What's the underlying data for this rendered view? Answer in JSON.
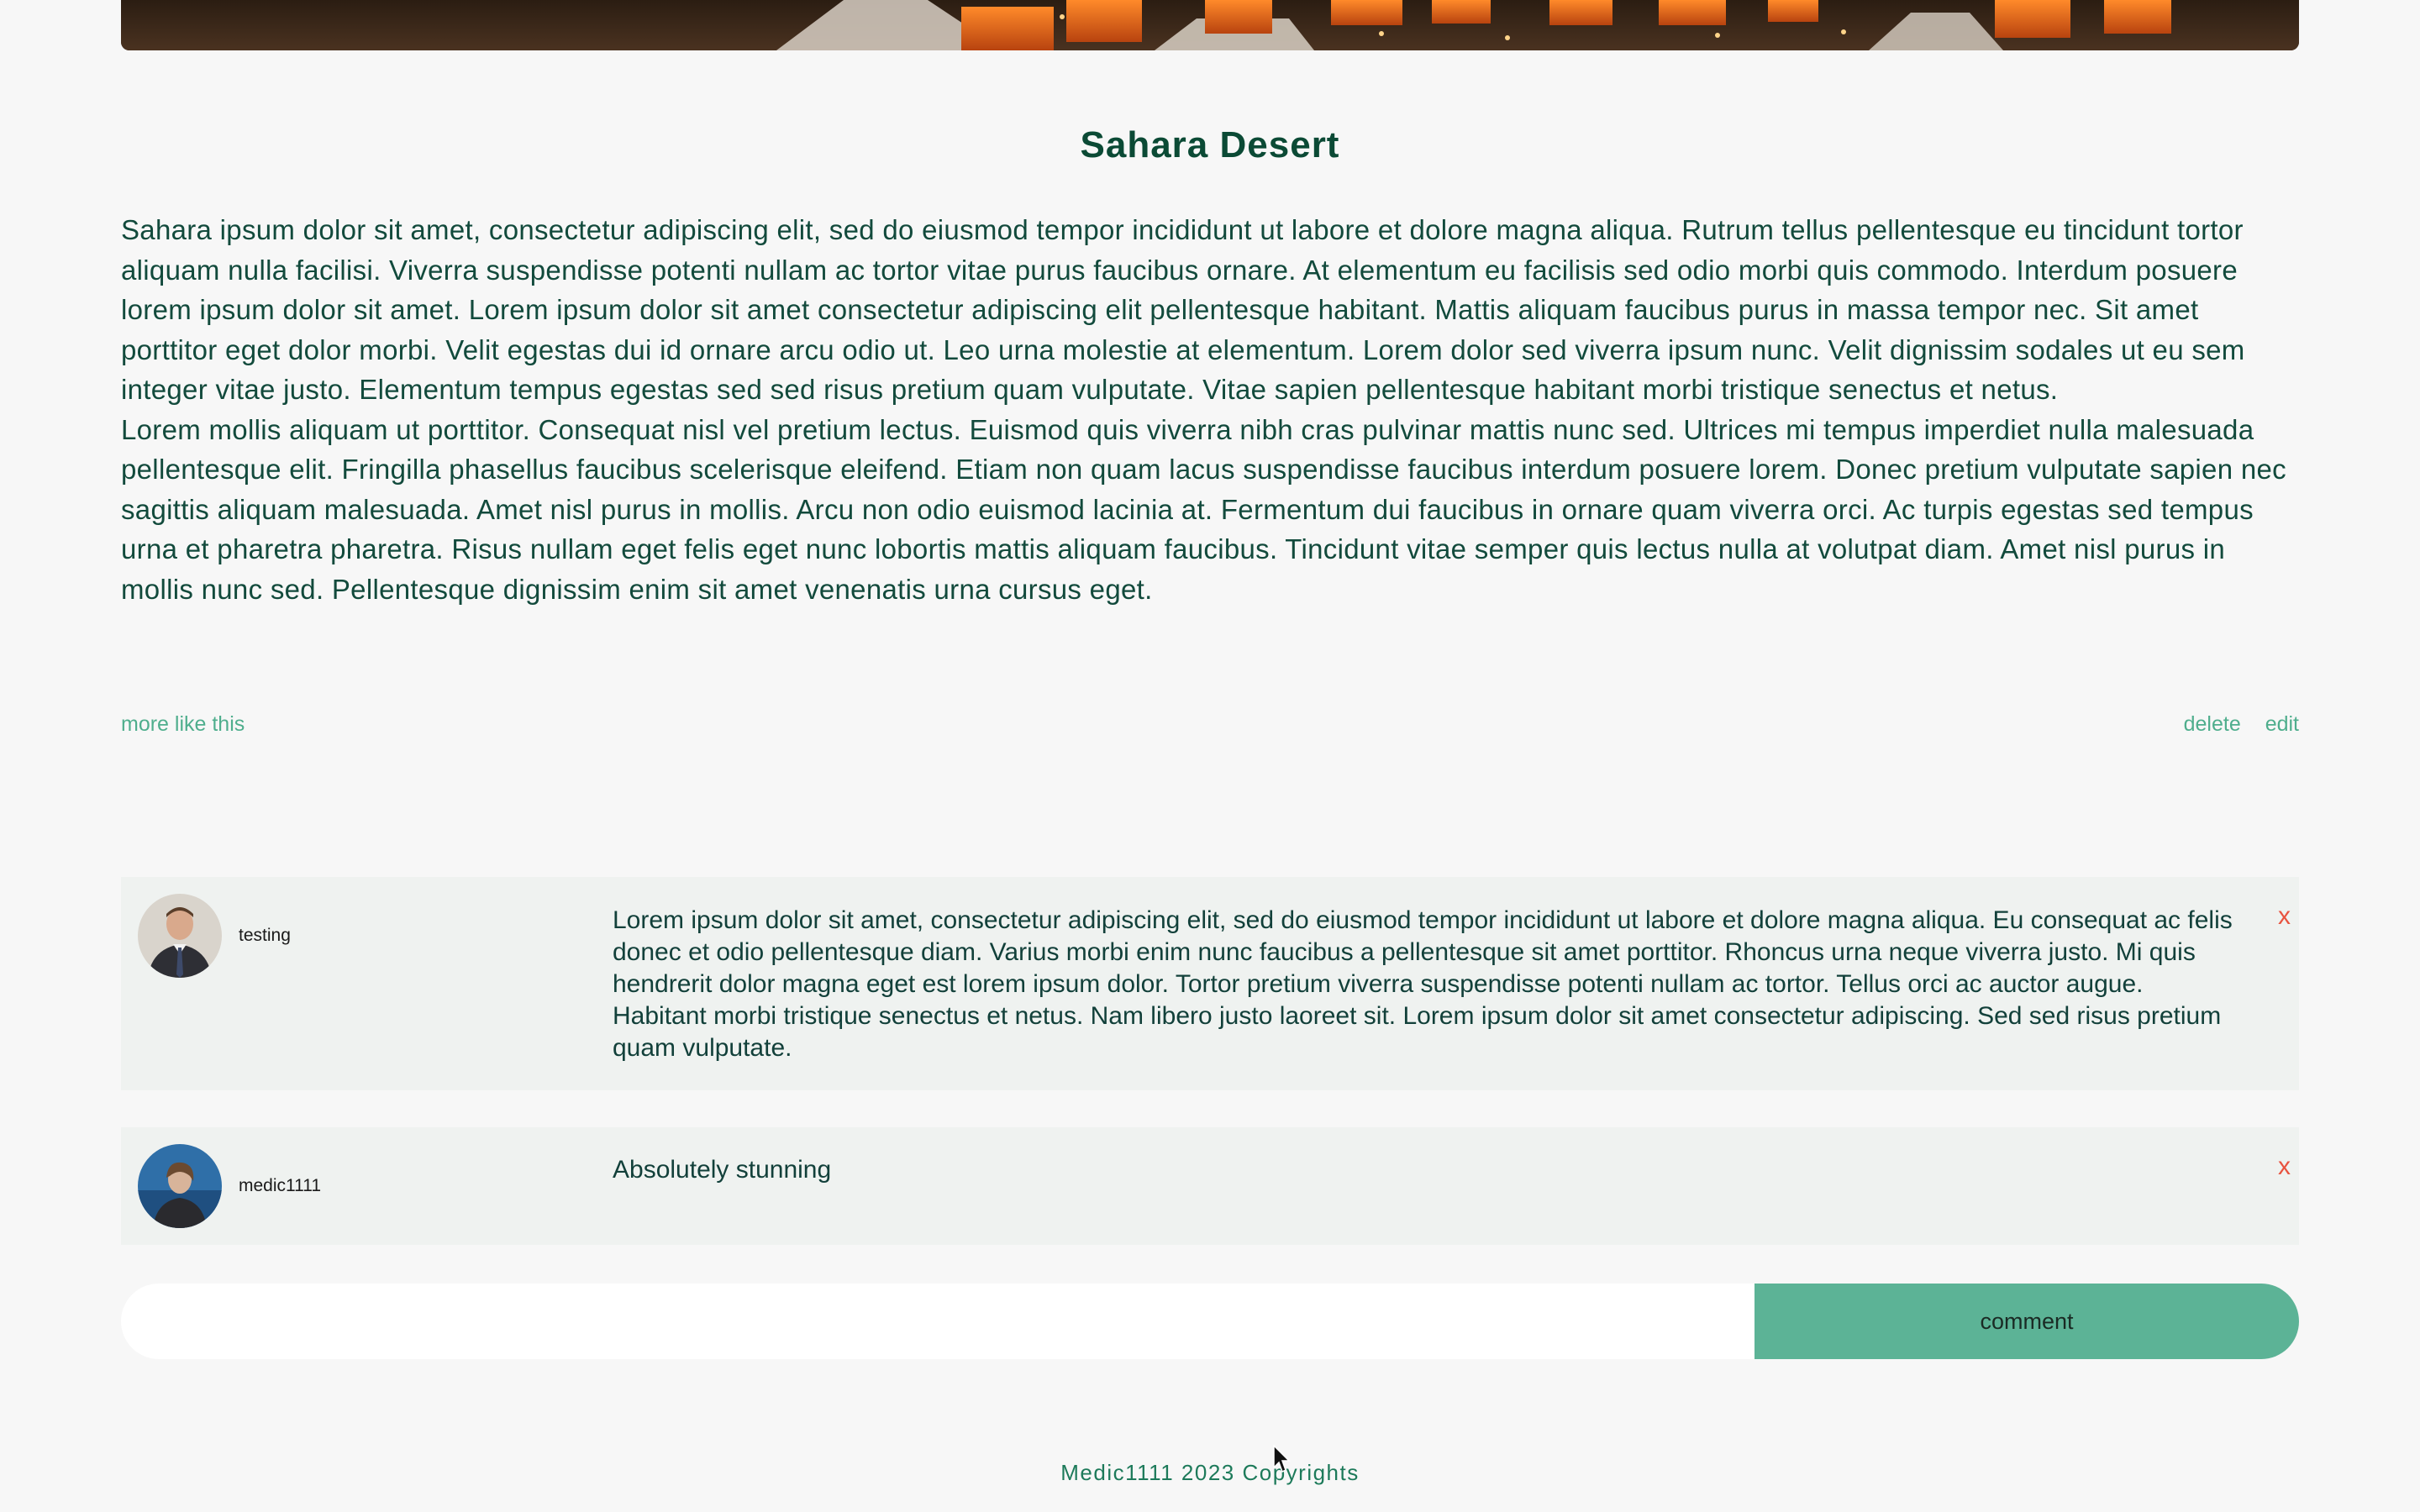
{
  "post": {
    "title": "Sahara Desert",
    "paragraphs": [
      "Sahara ipsum dolor sit amet, consectetur adipiscing elit, sed do eiusmod tempor incididunt ut labore et dolore magna aliqua. Rutrum tellus pellentesque eu tincidunt tortor aliquam nulla facilisi. Viverra suspendisse potenti nullam ac tortor vitae purus faucibus ornare. At elementum eu facilisis sed odio morbi quis commodo. Interdum posuere lorem ipsum dolor sit amet. Lorem ipsum dolor sit amet consectetur adipiscing elit pellentesque habitant. Mattis aliquam faucibus purus in massa tempor nec. Sit amet porttitor eget dolor morbi. Velit egestas dui id ornare arcu odio ut. Leo urna molestie at elementum. Lorem dolor sed viverra ipsum nunc. Velit dignissim sodales ut eu sem integer vitae justo. Elementum tempus egestas sed sed risus pretium quam vulputate. Vitae sapien pellentesque habitant morbi tristique senectus et netus.",
      "Lorem mollis aliquam ut porttitor. Consequat nisl vel pretium lectus. Euismod quis viverra nibh cras pulvinar mattis nunc sed. Ultrices mi tempus imperdiet nulla malesuada pellentesque elit. Fringilla phasellus faucibus scelerisque eleifend. Etiam non quam lacus suspendisse faucibus interdum posuere lorem. Donec pretium vulputate sapien nec sagittis aliquam malesuada. Amet nisl purus in mollis. Arcu non odio euismod lacinia at. Fermentum dui faucibus in ornare quam viverra orci. Ac turpis egestas sed tempus urna et pharetra pharetra. Risus nullam eget felis eget nunc lobortis mattis aliquam faucibus. Tincidunt vitae semper quis lectus nulla at volutpat diam. Amet nisl purus in mollis nunc sed. Pellentesque dignissim enim sit amet venenatis urna cursus eget."
    ],
    "more_link": "more like this",
    "delete_link": "delete",
    "edit_link": "edit"
  },
  "comments": [
    {
      "username": "testing",
      "text": "Lorem ipsum dolor sit amet, consectetur adipiscing elit, sed do eiusmod tempor incididunt ut labore et dolore magna aliqua. Eu consequat ac felis donec et odio pellentesque diam. Varius morbi enim nunc faucibus a pellentesque sit amet porttitor. Rhoncus urna neque viverra justo. Mi quis hendrerit dolor magna eget est lorem ipsum dolor. Tortor pretium viverra suspendisse potenti nullam ac tortor. Tellus orci ac auctor augue. Habitant morbi tristique senectus et netus. Nam libero justo laoreet sit. Lorem ipsum dolor sit amet consectetur adipiscing. Sed sed risus pretium quam vulputate.",
      "delete_label": "x"
    },
    {
      "username": "medic1111",
      "text": "Absolutely stunning",
      "delete_label": "x"
    }
  ],
  "comment_form": {
    "placeholder": "",
    "button_label": "comment"
  },
  "footer": {
    "text": "Medic1111 2023 Copyrights"
  },
  "colors": {
    "accent": "#5cb396",
    "link": "#4fae8d",
    "title": "#0b4a35",
    "delete": "#e8533f",
    "background": "#f7f7f7",
    "comment_bg": "#eff2f0"
  }
}
